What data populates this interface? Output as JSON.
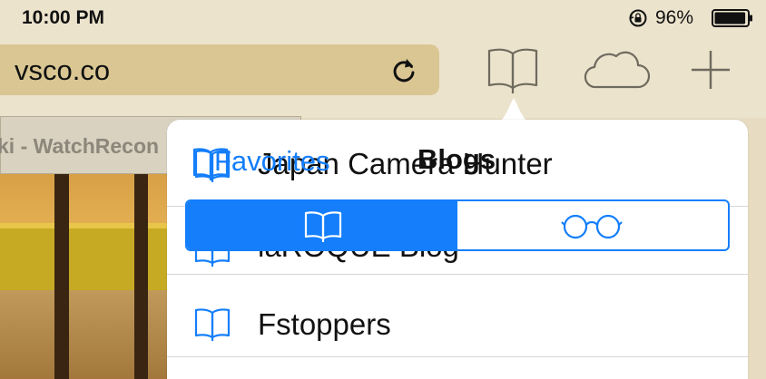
{
  "status_bar": {
    "time": "10:00 PM",
    "battery_percent": "96%",
    "orientation_lock_icon": "rotation-lock-icon",
    "battery_icon": "battery-icon",
    "battery_level": 0.96
  },
  "toolbar": {
    "address": "vsco.co",
    "reload_icon": "reload-icon",
    "bookmarks_icon": "open-book-icon",
    "icloud_tabs_icon": "cloud-icon",
    "new_tab_icon": "plus-icon"
  },
  "background_tab": {
    "label": "ki - WatchRecon"
  },
  "popover": {
    "back_label": "Favorites",
    "title": "Blogs",
    "segments": [
      {
        "name": "bookmarks",
        "icon": "open-book-icon",
        "selected": true
      },
      {
        "name": "reading-list",
        "icon": "glasses-icon",
        "selected": false
      }
    ],
    "items": [
      {
        "label": "Japan Camera Hunter",
        "icon": "open-book-icon"
      },
      {
        "label": "laROQUE Blog",
        "icon": "open-book-icon"
      },
      {
        "label": "Fstoppers",
        "icon": "open-book-icon"
      }
    ]
  },
  "colors": {
    "accent": "#147efb",
    "toolbar_bg": "#ece3cd",
    "address_bar_bg": "#d9c692"
  }
}
